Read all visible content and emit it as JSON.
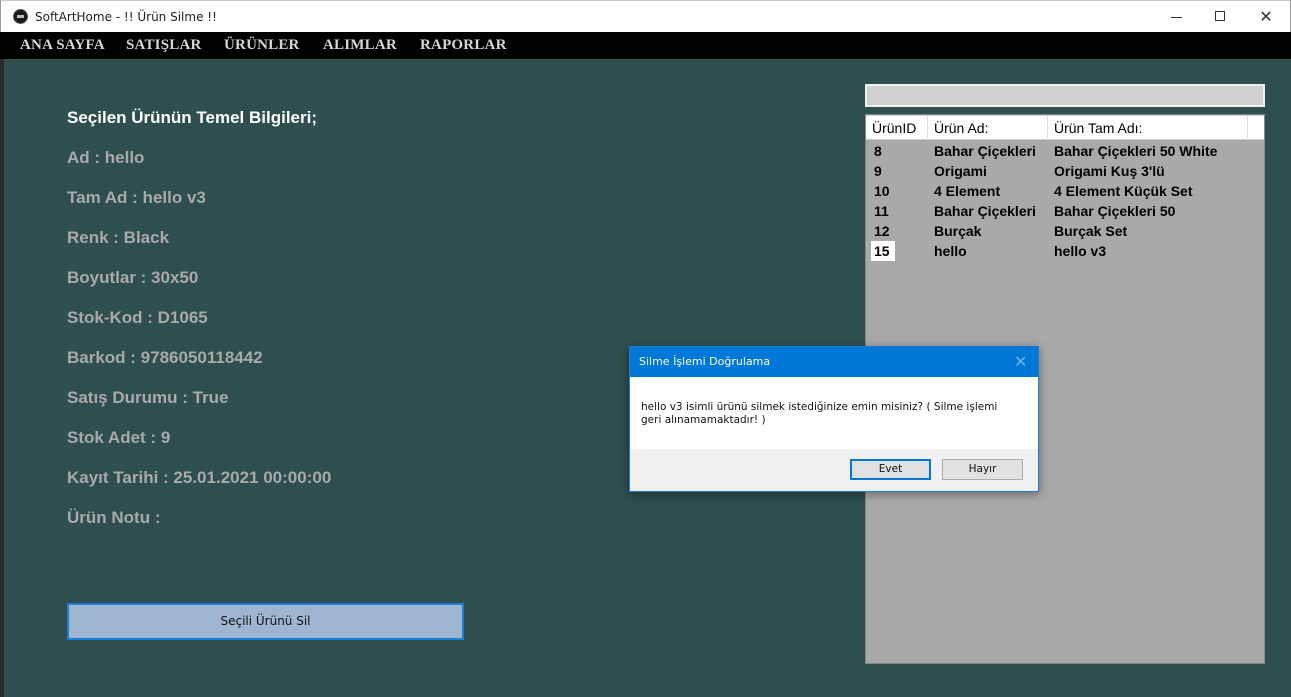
{
  "window": {
    "title": "SoftArtHome - !! Ürün Silme !!",
    "close_glyph": "✕"
  },
  "menu": {
    "items": [
      "ANA SAYFA",
      "SATIŞLAR",
      "ÜRÜNLER",
      "ALIMLAR",
      "RAPORLAR"
    ]
  },
  "product_info": {
    "heading": "Seçilen Ürünün Temel Bilgileri;",
    "lines": [
      "Ad : hello",
      "Tam Ad : hello v3",
      "Renk : Black",
      "Boyutlar : 30x50",
      "Stok-Kod : D1065",
      "Barkod : 9786050118442",
      "Satış Durumu : True",
      "Stok Adet : 9",
      "Kayıt Tarihi : 25.01.2021 00:00:00",
      "Ürün Notu : "
    ]
  },
  "delete_button": {
    "label": "Seçili Ürünü Sil"
  },
  "search": {
    "value": ""
  },
  "grid": {
    "columns": [
      "ÜrünID",
      "Ürün Ad:",
      "Ürün Tam Adı:"
    ],
    "rows": [
      {
        "id": "8",
        "name": "Bahar Çiçekleri",
        "full_name": "Bahar Çiçekleri 50 White"
      },
      {
        "id": "9",
        "name": "Origami",
        "full_name": "Origami Kuş 3'lü"
      },
      {
        "id": "10",
        "name": "4 Element",
        "full_name": "4 Element Küçük Set"
      },
      {
        "id": "11",
        "name": "Bahar Çiçekleri",
        "full_name": "Bahar Çiçekleri 50"
      },
      {
        "id": "12",
        "name": "Burçak",
        "full_name": "Burçak Set"
      },
      {
        "id": "15",
        "name": "hello",
        "full_name": "hello v3"
      }
    ],
    "selected_id": "15"
  },
  "dialog": {
    "title": "Silme İşlemi Doğrulama",
    "message": "hello v3 isimli ürünü silmek istediğinize emin misiniz? ( Silme işlemi geri alınamamaktadır! )",
    "yes_label": "Evet",
    "no_label": "Hayır",
    "close_glyph": "✕"
  },
  "colors": {
    "main_background": "#2f4f4f",
    "menu_background": "#000000",
    "info_text": "#a9a9a9",
    "grid_background": "#a9a9a9",
    "dialog_accent": "#0078d7"
  }
}
